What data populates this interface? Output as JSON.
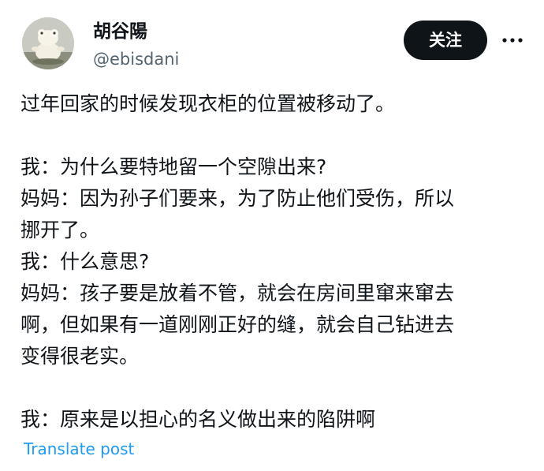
{
  "post": {
    "author": {
      "display_name": "胡谷陽",
      "handle": "@ebisdani",
      "avatar_icon": "frog-figure-avatar"
    },
    "follow_label": "关注",
    "more_icon": "more-horizontal-icon",
    "body_lines": [
      "过年回家的时候发现衣柜的位置被移动了。",
      "",
      "我：为什么要特地留一个空隙出来?",
      "妈妈：因为孙子们要来，为了防止他们受伤，所以",
      "挪开了。",
      "我：什么意思?",
      "妈妈：孩子要是放着不管，就会在房间里窜来窜去",
      "啊，但如果有一道刚刚正好的缝，就会自己钻进去",
      "变得很老实。",
      "",
      "我：原来是以担心的名义做出来的陷阱啊"
    ],
    "translate_label": "Translate post"
  },
  "colors": {
    "text_primary": "#0f1419",
    "text_secondary": "#536471",
    "link": "#1d9bf0",
    "button_bg": "#0f1419",
    "button_text": "#ffffff"
  }
}
